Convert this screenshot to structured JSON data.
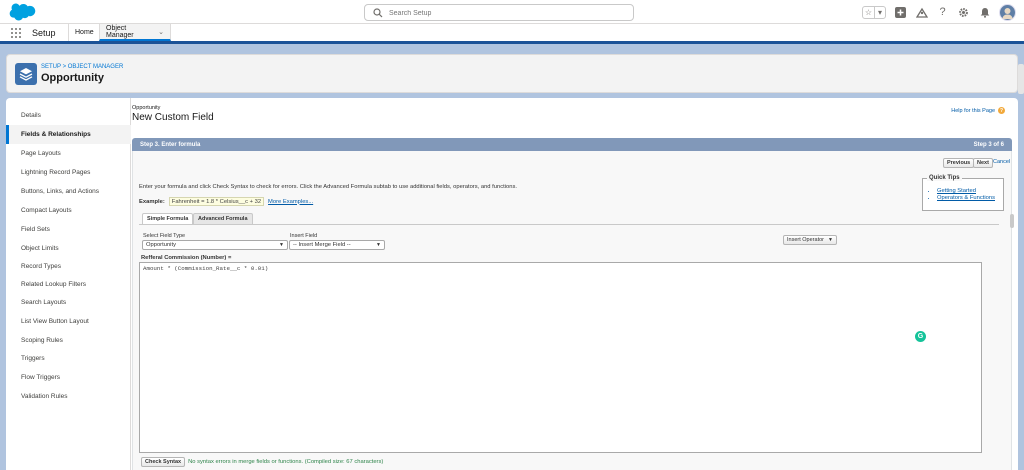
{
  "header": {
    "search_placeholder": "Search Setup"
  },
  "context_bar": {
    "app_name": "Setup",
    "tabs": [
      {
        "label": "Home"
      },
      {
        "label": "Object Manager"
      }
    ]
  },
  "object": {
    "breadcrumb": "SETUP > OBJECT MANAGER",
    "title": "Opportunity"
  },
  "sidebar": {
    "items": [
      {
        "label": "Details"
      },
      {
        "label": "Fields & Relationships"
      },
      {
        "label": "Page Layouts"
      },
      {
        "label": "Lightning Record Pages"
      },
      {
        "label": "Buttons, Links, and Actions"
      },
      {
        "label": "Compact Layouts"
      },
      {
        "label": "Field Sets"
      },
      {
        "label": "Object Limits"
      },
      {
        "label": "Record Types"
      },
      {
        "label": "Related Lookup Filters"
      },
      {
        "label": "Search Layouts"
      },
      {
        "label": "List View Button Layout"
      },
      {
        "label": "Scoping Rules"
      },
      {
        "label": "Triggers"
      },
      {
        "label": "Flow Triggers"
      },
      {
        "label": "Validation Rules"
      }
    ],
    "active_index": 1
  },
  "page": {
    "object_label": "Opportunity",
    "title": "New Custom Field",
    "help_link": "Help for this Page",
    "step_title": "Step 3. Enter formula",
    "step_count": "Step 3 of 6",
    "buttons": {
      "previous": "Previous",
      "next": "Next",
      "cancel": "Cancel"
    },
    "instructions": "Enter your formula and click Check Syntax to check for errors. Click the Advanced Formula subtab to use additional fields, operators, and functions.",
    "example_label": "Example:",
    "example_code": "Fahrenheit = 1.8 * Celsius__c + 32",
    "more_examples": "More Examples...",
    "quick_tips": {
      "title": "Quick Tips",
      "links": [
        "Getting Started",
        "Operators & Functions"
      ]
    },
    "formula_tabs": [
      "Simple Formula",
      "Advanced Formula"
    ],
    "select_field_type_label": "Select Field Type",
    "select_field_type_value": "Opportunity",
    "insert_field_label": "Insert Field",
    "insert_field_value": "-- Insert Merge Field --",
    "insert_operator": "Insert Operator",
    "formula_field_label": "Refferal Commission (Number) =",
    "formula_text": "Amount * (Commission_Rate__c * 0.01)",
    "check_syntax": "Check Syntax",
    "syntax_status": "No syntax errors in merge fields or functions. (Compiled size: 67 characters)"
  },
  "colors": {
    "brand_blue": "#0176d3",
    "step_bar": "#8198b9",
    "success_green": "#2e844a",
    "object_icon": "#3c70ad"
  }
}
